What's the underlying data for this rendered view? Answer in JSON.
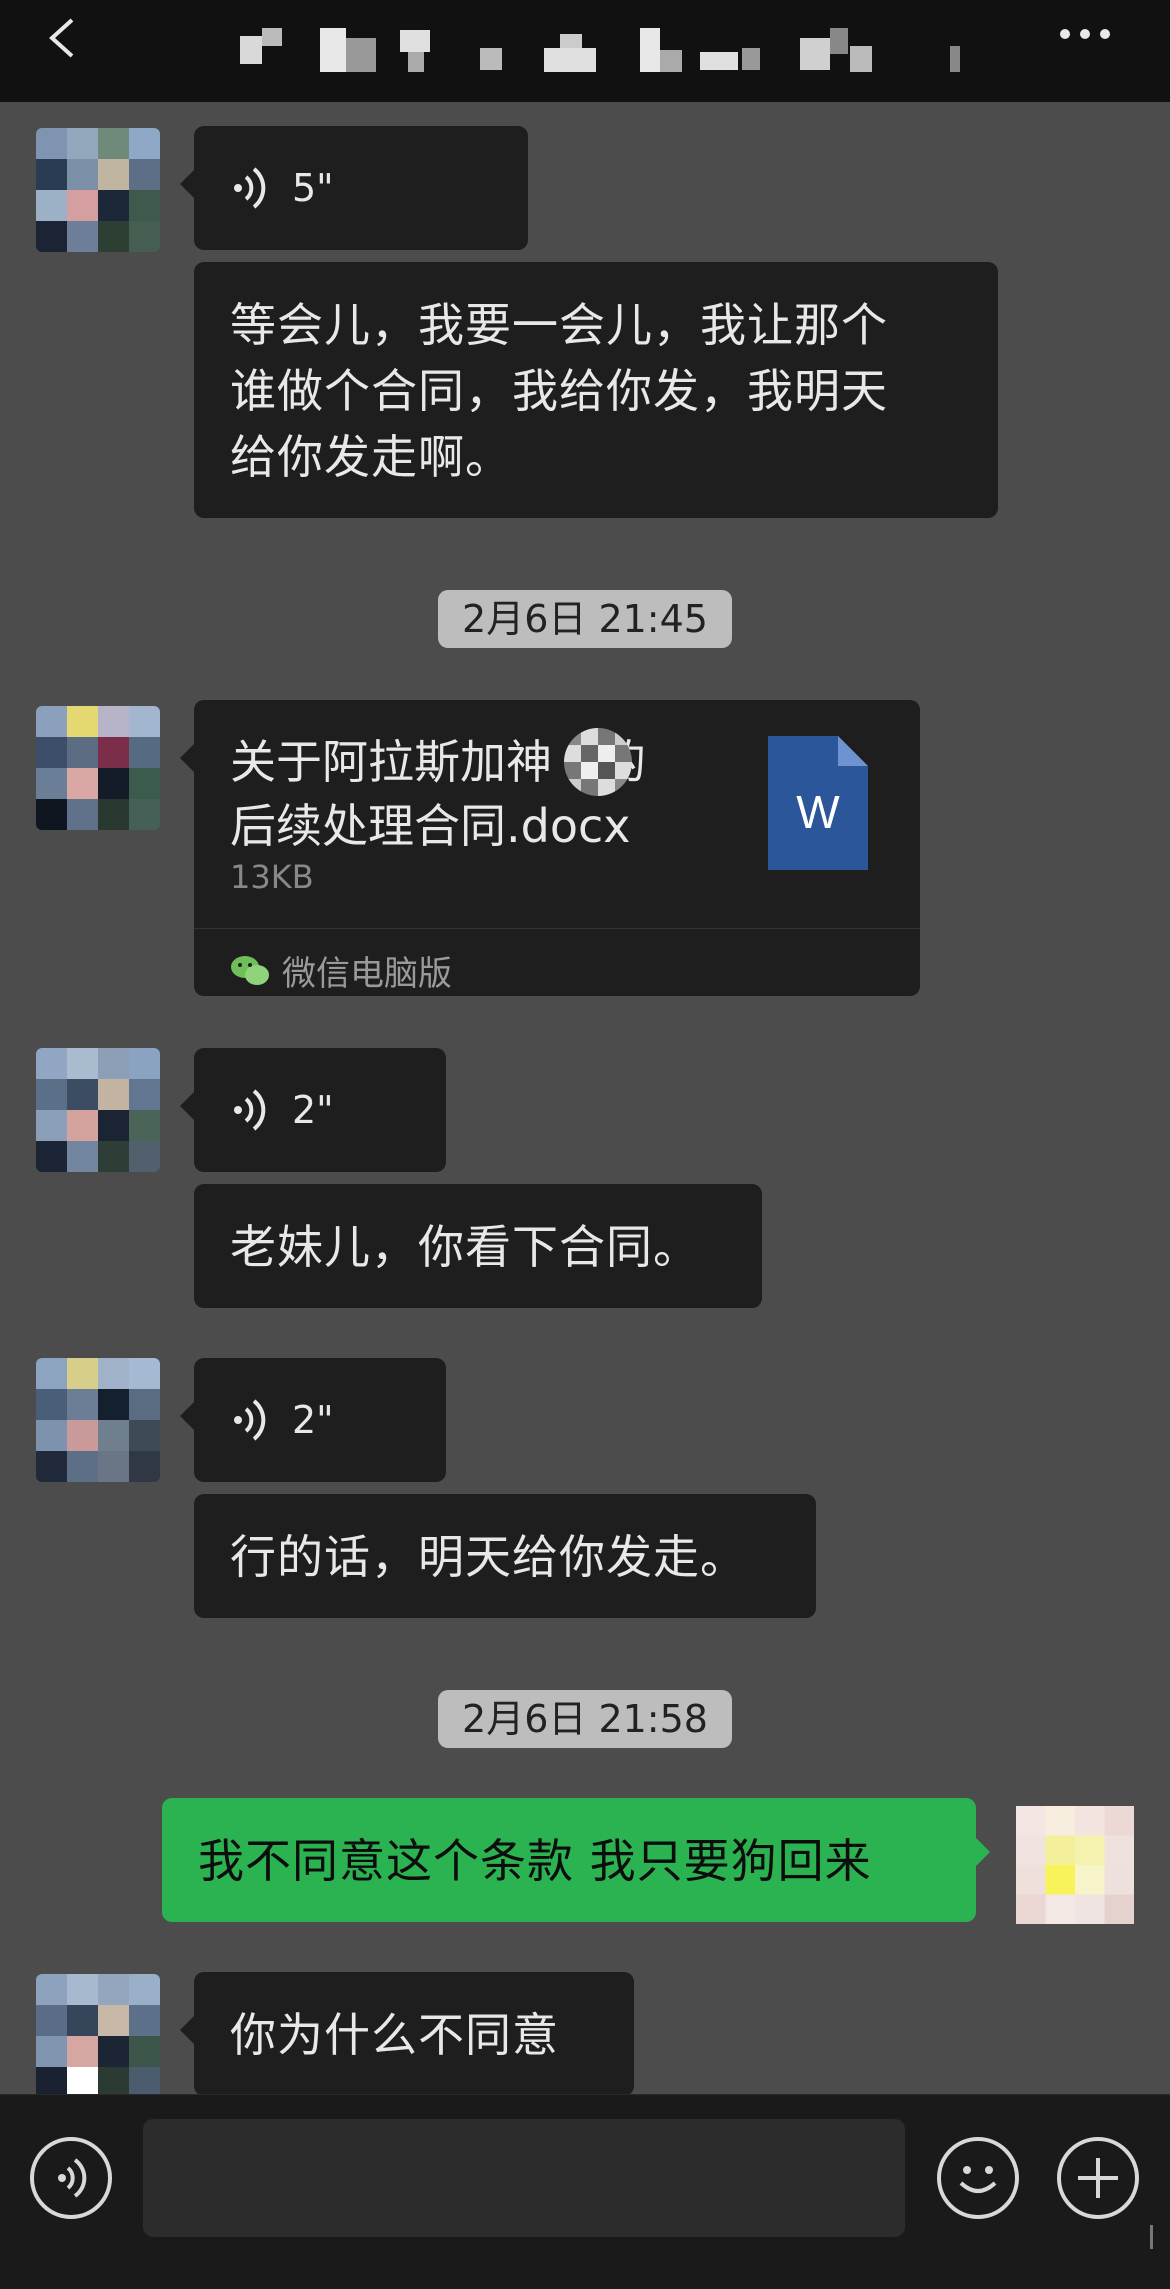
{
  "header": {
    "back_icon": "chevron-left-icon",
    "more_icon": "ellipsis-icon",
    "title_obscured": true
  },
  "messages": [
    {
      "type": "voice",
      "side": "left",
      "duration": "5\""
    },
    {
      "type": "text",
      "side": "left",
      "lines": [
        "等会儿，我要一会儿，我让那个",
        "谁做个合同，我给你发，我明天",
        "给你发走啊。"
      ]
    },
    {
      "type": "timestamp",
      "text": "2月6日 21:45"
    },
    {
      "type": "file",
      "side": "left",
      "name_lines": [
        "关于阿拉斯加神",
        "的",
        "后续处理合同.docx"
      ],
      "size": "13KB",
      "source": "微信电脑版",
      "icon_letter": "W"
    },
    {
      "type": "voice",
      "side": "left",
      "duration": "2\""
    },
    {
      "type": "text",
      "side": "left",
      "lines": [
        "老妹儿，你看下合同。"
      ]
    },
    {
      "type": "voice",
      "side": "left",
      "duration": "2\""
    },
    {
      "type": "text",
      "side": "left",
      "lines": [
        "行的话，明天给你发走。"
      ]
    },
    {
      "type": "timestamp",
      "text": "2月6日 21:58"
    },
    {
      "type": "text",
      "side": "right",
      "lines": [
        "我不同意这个条款 我只要狗回来"
      ]
    },
    {
      "type": "text",
      "side": "left",
      "lines": [
        "你为什么不同意"
      ]
    }
  ],
  "bottom_bar": {
    "voice_icon": "voice-mode-icon",
    "input_value": "",
    "emoji_icon": "emoji-icon",
    "plus_icon": "plus-icon"
  },
  "colors": {
    "chat_background": "#4c4c4c",
    "received_bubble": "#1e1e1e",
    "sent_bubble": "#2bb352",
    "timestamp_pill": "#bdbdbd",
    "word_icon": "#2b579a"
  }
}
